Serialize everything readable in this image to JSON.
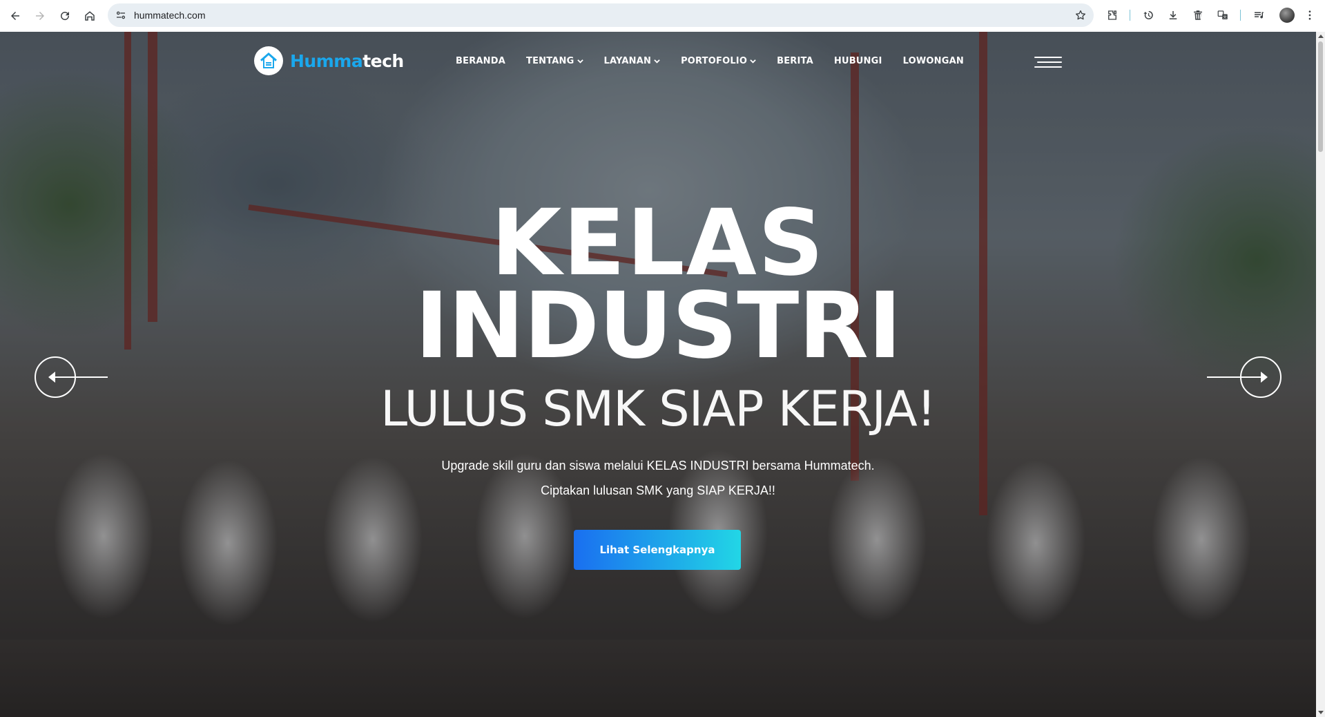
{
  "browser": {
    "url": "hummatech.com",
    "icons": [
      "back-icon",
      "forward-icon",
      "reload-icon",
      "home-icon",
      "site-info-icon",
      "bookmark-star-icon",
      "extensions-icon",
      "history-icon",
      "download-icon",
      "delete-icon",
      "translate-icon",
      "media-controls-icon",
      "profile-avatar",
      "more-menu-icon"
    ]
  },
  "site": {
    "logo": {
      "part1": "Humma",
      "part2": "tech",
      "accent": "#1aa7ec"
    },
    "nav": [
      {
        "label": "BERANDA",
        "dropdown": false
      },
      {
        "label": "TENTANG",
        "dropdown": true
      },
      {
        "label": "LAYANAN",
        "dropdown": true
      },
      {
        "label": "PORTOFOLIO",
        "dropdown": true
      },
      {
        "label": "BERITA",
        "dropdown": false
      },
      {
        "label": "HUBUNGI",
        "dropdown": false
      },
      {
        "label": "LOWONGAN",
        "dropdown": false
      }
    ]
  },
  "hero": {
    "title_line1": "KELAS",
    "title_line2": "INDUSTRI",
    "subtitle": "LULUS SMK SIAP KERJA!",
    "description_line1": "Upgrade skill guru dan siswa melalui KELAS INDUSTRI bersama Hummatech.",
    "description_line2": "Ciptakan lulusan SMK yang SIAP KERJA!!",
    "cta_label": "Lihat Selengkapnya",
    "cta_gradient": [
      "#1a6ff0",
      "#22d6e6"
    ]
  }
}
